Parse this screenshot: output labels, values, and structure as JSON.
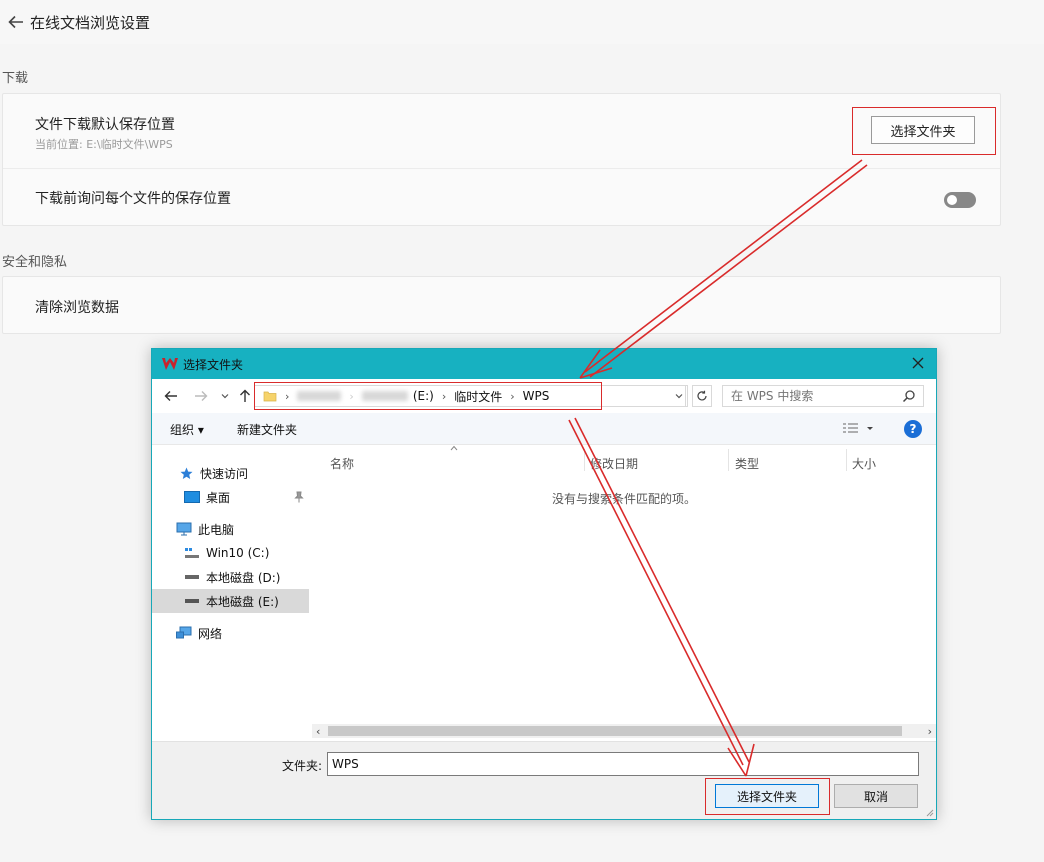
{
  "page": {
    "title": "在线文档浏览设置"
  },
  "download_section": {
    "label": "下载",
    "default_location_title": "文件下载默认保存位置",
    "current_location": "当前位置: E:\\临时文件\\WPS",
    "select_folder_label": "选择文件夹",
    "ask_each_time_title": "下载前询问每个文件的保存位置",
    "ask_each_time_enabled": false
  },
  "privacy_section": {
    "label": "安全和隐私",
    "clear_data_title": "清除浏览数据"
  },
  "dialog": {
    "title": "选择文件夹",
    "breadcrumbs": [
      "(E:)",
      "临时文件",
      "WPS"
    ],
    "search_placeholder": "在 WPS 中搜索",
    "toolbar": {
      "organize": "组织 ▾",
      "new_folder": "新建文件夹"
    },
    "nav_items": [
      {
        "label": "快速访问",
        "icon": "star-icon"
      },
      {
        "label": "桌面",
        "icon": "desktop-icon"
      },
      {
        "label": "此电脑",
        "icon": "computer-icon"
      },
      {
        "label": "Win10 (C:)",
        "icon": "system-drive-icon"
      },
      {
        "label": "本地磁盘 (D:)",
        "icon": "drive-icon"
      },
      {
        "label": "本地磁盘 (E:)",
        "icon": "drive-icon",
        "selected": true
      },
      {
        "label": "网络",
        "icon": "network-icon"
      }
    ],
    "columns": [
      "名称",
      "修改日期",
      "类型",
      "大小"
    ],
    "empty_message": "没有与搜索条件匹配的项。",
    "folder_label": "文件夹:",
    "folder_value": "WPS",
    "ok_label": "选择文件夹",
    "cancel_label": "取消"
  },
  "colors": {
    "titlebar": "#17b1c1",
    "highlight": "#d92b2b",
    "primary_button_border": "#0078d7"
  }
}
